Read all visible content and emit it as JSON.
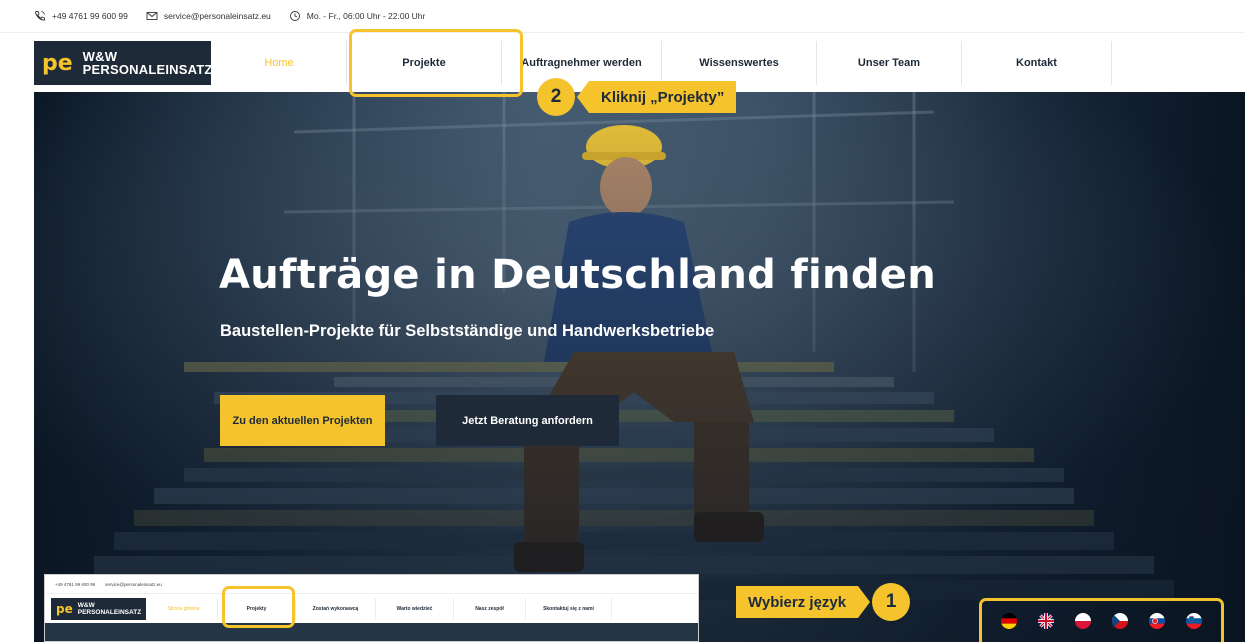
{
  "topbar": {
    "phone": "+49 4761 99 600 99",
    "email": "service@personaleinsatz.eu",
    "hours": "Mo. - Fr., 06:00 Uhr - 22:00 Uhr"
  },
  "logo": {
    "mark": "pe",
    "line1": "W&W",
    "line2": "PERSONALEINSATZ"
  },
  "nav": {
    "items": [
      {
        "label": "Home",
        "active": true
      },
      {
        "label": "Projekte",
        "active": false
      },
      {
        "label": "Auftragnehmer werden",
        "active": false
      },
      {
        "label": "Wissenswertes",
        "active": false
      },
      {
        "label": "Unser Team",
        "active": false
      },
      {
        "label": "Kontakt",
        "active": false
      }
    ]
  },
  "hero": {
    "title": "Aufträge in Deutschland finden",
    "subtitle": "Baustellen-Projekte für Selbstständige und Handwerksbetriebe",
    "cta_primary": "Zu den aktuellen Projekten",
    "cta_secondary": "Jetzt Beratung anfordern"
  },
  "annotations": {
    "step1": {
      "number": "1",
      "label": "Wybierz język"
    },
    "step2": {
      "number": "2",
      "label": "Kliknij „Projekty”"
    }
  },
  "inset": {
    "phone": "+49 4761 99 600 99",
    "email": "service@personaleinsatz.eu",
    "nav": [
      {
        "label": "Strona główna",
        "active": true
      },
      {
        "label": "Projekty",
        "active": false
      },
      {
        "label": "Zostań wykonawcą",
        "active": false
      },
      {
        "label": "Warto wiedzieć",
        "active": false
      },
      {
        "label": "Nasz zespół",
        "active": false
      },
      {
        "label": "Skontaktuj się z nami",
        "active": false
      }
    ]
  },
  "languages": [
    "de",
    "en",
    "pl",
    "cz",
    "sk",
    "si"
  ],
  "colors": {
    "accent": "#f5c32c",
    "navy": "#1e2a38"
  }
}
